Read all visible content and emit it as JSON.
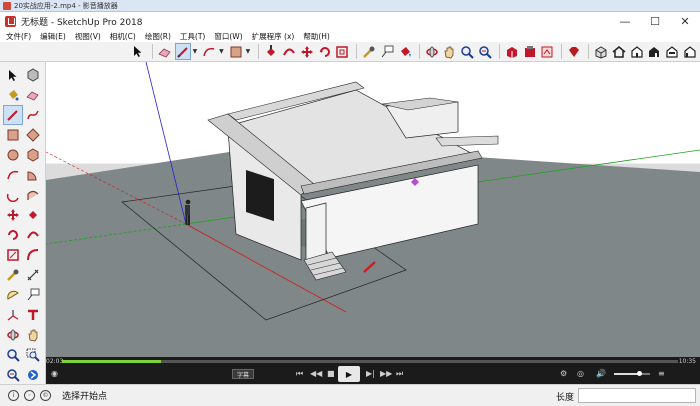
{
  "player": {
    "title": "20实战应用-2.mp4 - 影音播放器"
  },
  "window": {
    "title": "无标题 - SketchUp Pro 2018",
    "minimize": "—",
    "maximize": "☐",
    "close": "✕"
  },
  "menu": [
    {
      "label": "文件(F)"
    },
    {
      "label": "编辑(E)"
    },
    {
      "label": "视图(V)"
    },
    {
      "label": "相机(C)"
    },
    {
      "label": "绘图(R)"
    },
    {
      "label": "工具(T)"
    },
    {
      "label": "窗口(W)"
    },
    {
      "label": "扩展程序 (x)"
    },
    {
      "label": "帮助(H)"
    }
  ],
  "toolbar": {
    "buttons": [
      "select-arrow",
      "eraser",
      "pencil-line",
      "arc",
      "rectangle",
      "push-pull",
      "follow-me",
      "move",
      "rotate",
      "offset",
      "tape-measure",
      "text",
      "paint-bucket",
      "orbit",
      "pan",
      "zoom",
      "zoom-extents",
      "3d-warehouse",
      "extension-warehouse",
      "layout",
      "ruby",
      "iso-view",
      "top-view",
      "front-view",
      "right-view",
      "back-view",
      "left-view"
    ],
    "active": "pencil-line"
  },
  "palette": {
    "active": "pencil-line"
  },
  "scene": {
    "model_description_colors": {
      "ground": "#7f8789",
      "wall": "#f2f2f2",
      "roof": "#e6e6e6",
      "axis_red": "#d11b1b",
      "axis_green": "#1fa21f",
      "axis_blue": "#2323d8"
    }
  },
  "media": {
    "time_elapsed": "02:03",
    "time_total": "10:35",
    "progress": 0.16,
    "subtitle_label": "字幕",
    "volume": 0.7
  },
  "status": {
    "hint": "选择开始点",
    "measure_label": "长度",
    "measure_value": ""
  }
}
